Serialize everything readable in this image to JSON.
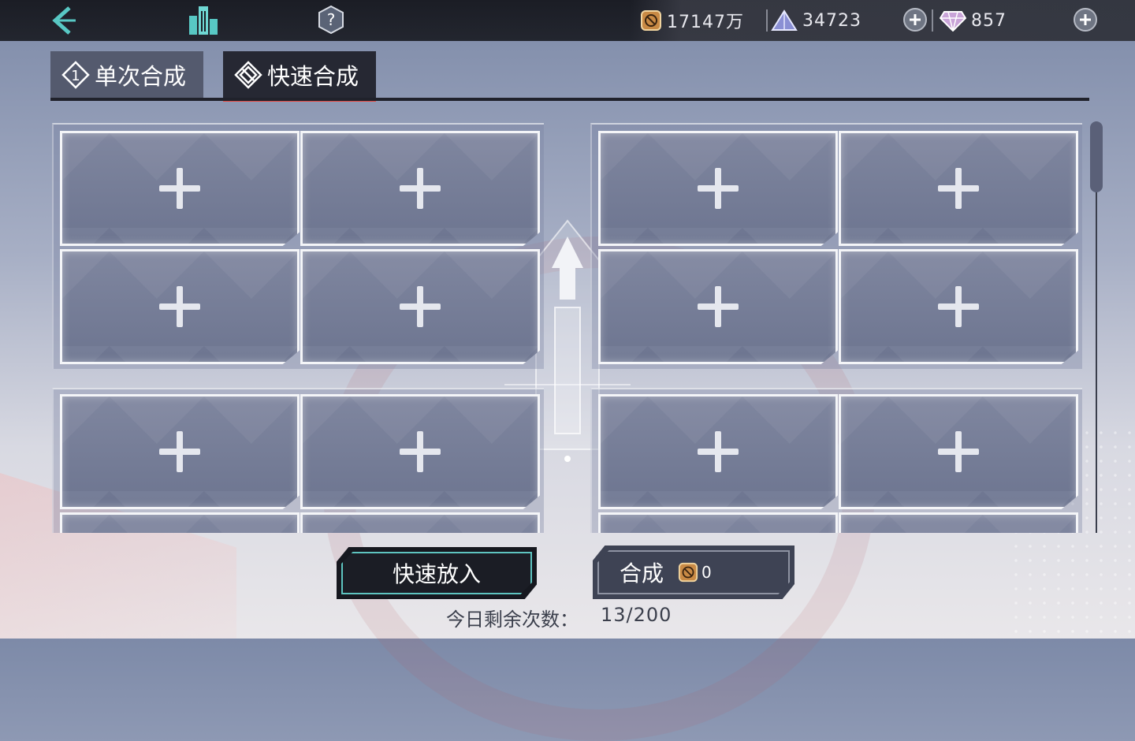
{
  "topbar": {
    "back_icon": "back-chevron-icon",
    "city_icon": "city-buildings-icon",
    "help_icon": "help-question-icon",
    "resources": [
      {
        "icon": "gold-coin-icon",
        "value": "17147万"
      },
      {
        "icon": "crystal-pyramid-icon",
        "value": "34723"
      },
      {
        "icon": "diamond-gem-icon",
        "value": "857"
      }
    ]
  },
  "tabs": [
    {
      "label": "单次合成",
      "icon": "single-synth-icon",
      "selected": false
    },
    {
      "label": "快速合成",
      "icon": "quick-synth-icon",
      "selected": true
    }
  ],
  "slots": {
    "empty_icon": "plus-icon",
    "visible_groups": 4,
    "slots_per_group": 4
  },
  "actions": {
    "quick_put_label": "快速放入",
    "synth_label": "合成",
    "synth_cost_icon": "gold-coin-icon",
    "synth_cost_value": "0"
  },
  "remaining": {
    "label": "今日剩余次数：",
    "value": "13/200"
  },
  "colors": {
    "accent_red": "#e0483f",
    "accent_teal": "#5ec4c0",
    "topbar_bg": "#1b1d25"
  }
}
